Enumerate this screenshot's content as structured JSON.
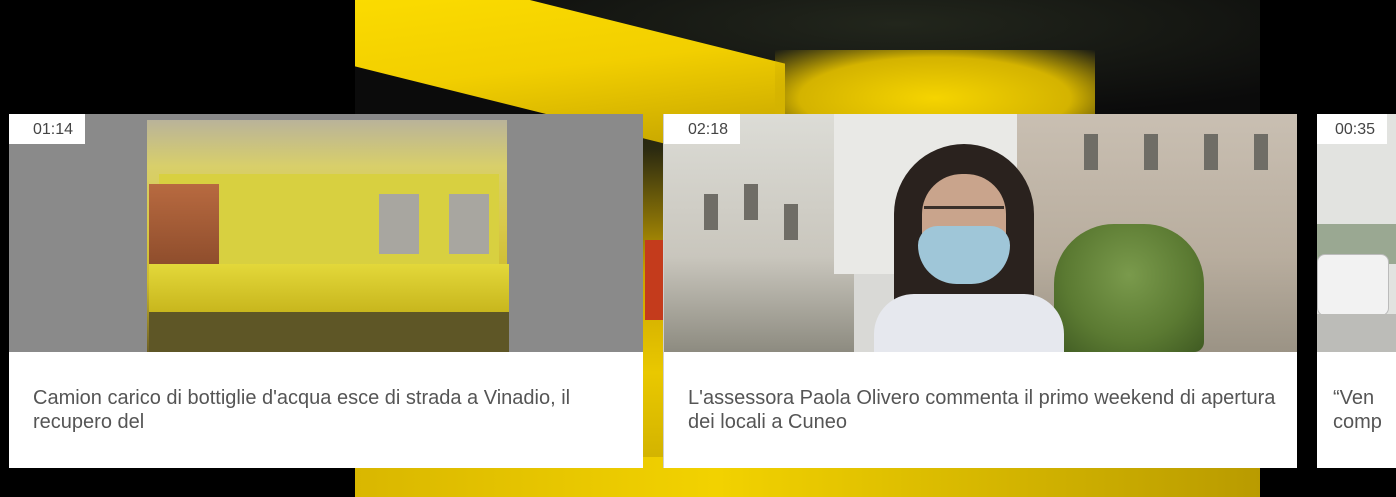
{
  "carousel": {
    "cards": [
      {
        "duration": "01:14",
        "title": "Camion carico di bottiglie d'acqua esce di strada a Vinadio, il recupero del"
      },
      {
        "duration": "02:18",
        "title": "L'assessora Paola Olivero commenta il primo weekend di apertura dei locali a Cuneo"
      },
      {
        "duration": "00:35",
        "title": "“Ven comp"
      }
    ]
  }
}
